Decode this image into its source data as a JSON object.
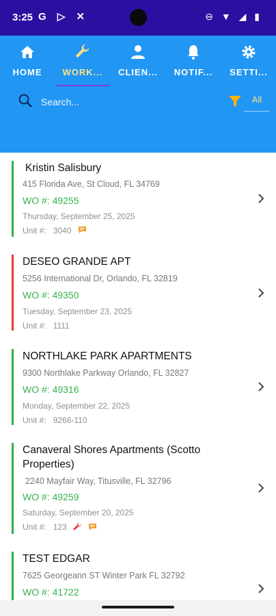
{
  "status_bar": {
    "time": "3:25",
    "left_icons": "G ▷ ✕",
    "right_icons": "⊖ ▼ ◢ ▮"
  },
  "tabs": [
    {
      "label": "HOME",
      "icon": "home-icon",
      "active": false
    },
    {
      "label": "WORK...",
      "icon": "wrench-icon",
      "active": true
    },
    {
      "label": "CLIEN...",
      "icon": "person-icon",
      "active": false
    },
    {
      "label": "NOTIF...",
      "icon": "bell-icon",
      "active": false
    },
    {
      "label": "SETTI...",
      "icon": "gear-icon",
      "active": false
    }
  ],
  "search": {
    "placeholder": "Search..."
  },
  "filter": {
    "label": "All",
    "icon": "filter-icon"
  },
  "work_orders": [
    {
      "client": "Kristin Salisbury",
      "address": "415 Florida Ave, St Cloud, FL 34769",
      "wo_label": "WO #:",
      "wo_number": "49255",
      "date": "Thursday, September 25, 2025",
      "unit_label": "Unit #:",
      "unit": "3040",
      "status_color": "#2db34a",
      "icons": [
        "comment-icon"
      ]
    },
    {
      "client": "DESEO GRANDE APT",
      "address": "5256 International Dr, Orlando, FL 32819",
      "wo_label": "WO #:",
      "wo_number": "49350",
      "date": "Tuesday, September 23, 2025",
      "unit_label": "Unit #:",
      "unit": "1111",
      "status_color": "#e53935",
      "icons": []
    },
    {
      "client": "NORTHLAKE PARK APARTMENTS",
      "address": "9300 Northlake Parkway Orlando, FL 32827",
      "wo_label": "WO #:",
      "wo_number": "49316",
      "date": "Monday, September 22, 2025",
      "unit_label": "Unit #:",
      "unit": "9266-110",
      "status_color": "#2db34a",
      "icons": []
    },
    {
      "client": "Canaveral Shores Apartments (Scotto Properties)",
      "address": "2240 Mayfair Way, Titusville, FL 32796",
      "wo_label": "WO #:",
      "wo_number": "49259",
      "date": "Saturday, September 20, 2025",
      "unit_label": "Unit #:",
      "unit": "123",
      "status_color": "#2db34a",
      "icons": [
        "tool-icon",
        "comment-icon"
      ]
    },
    {
      "client": "TEST EDGAR",
      "address": "7625 Georgeann ST Winter Park FL 32792",
      "wo_label": "WO #:",
      "wo_number": "41722",
      "date": "",
      "unit_label": "",
      "unit": "",
      "status_color": "#2db34a",
      "icons": []
    }
  ],
  "colors": {
    "status_bar": "#2a0fa0",
    "header": "#2196f3",
    "accent_yellow": "#ffe082",
    "wo_green": "#34b34a"
  }
}
